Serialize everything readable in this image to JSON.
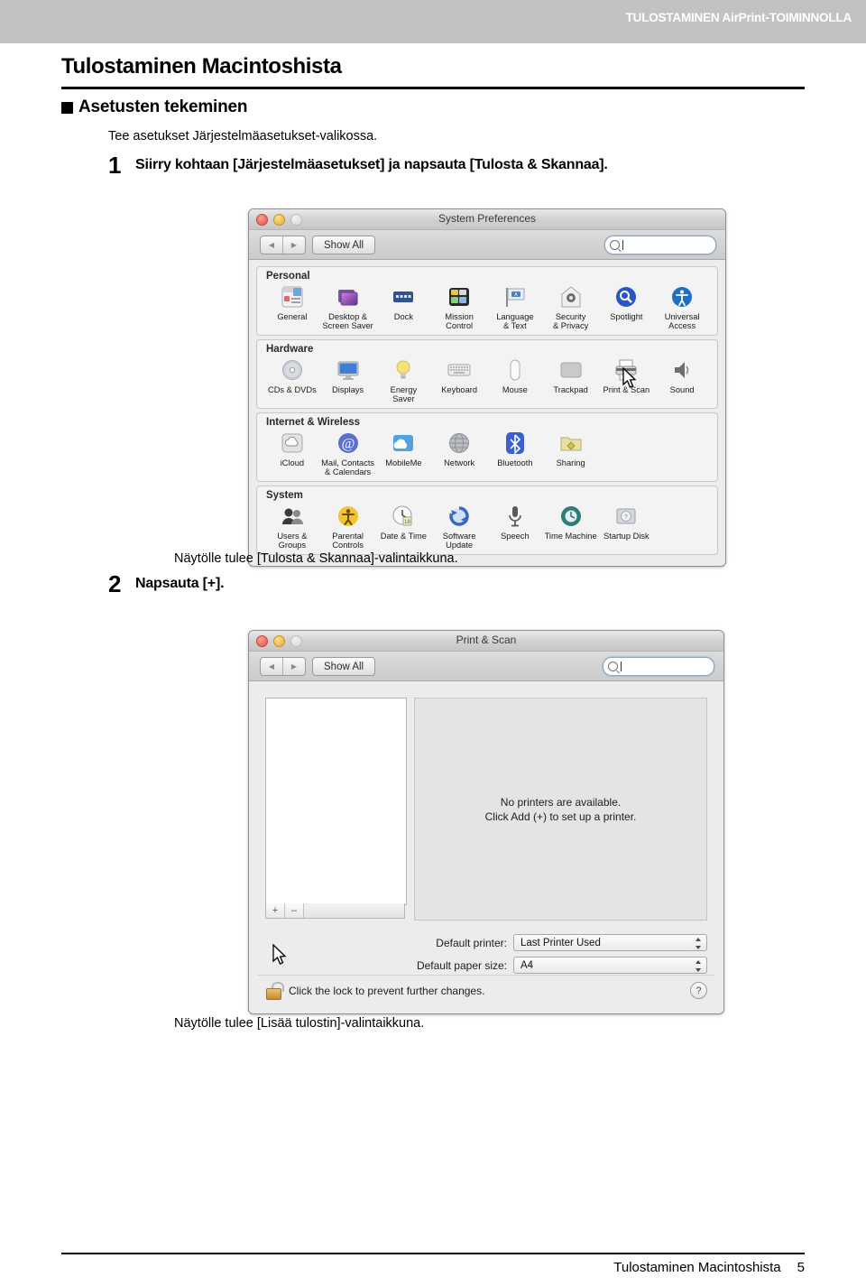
{
  "header": {
    "running_head": "TULOSTAMINEN AirPrint-TOIMINNOLLA",
    "band_color": "#c2c2c2"
  },
  "page": {
    "chapter_title": "Tulostaminen Macintoshista",
    "section_title": "Asetusten tekeminen",
    "intro": "Tee asetukset Järjestelmäasetukset-valikossa.",
    "footer_title": "Tulostaminen Macintoshista",
    "footer_page": "5"
  },
  "steps": [
    {
      "number": "1",
      "text": "Siirry kohtaan [Järjestelmäasetukset] ja napsauta [Tulosta & Skannaa].",
      "caption_after": "Näytölle tulee [Tulosta & Skannaa]-valintaikkuna."
    },
    {
      "number": "2",
      "text": "Napsauta [+].",
      "caption_after": "Näytölle tulee [Lisää tulostin]-valintaikkuna."
    }
  ],
  "system_preferences": {
    "window_title": "System Preferences",
    "toolbar": {
      "back_label": "◀",
      "forward_label": "▶",
      "show_all_label": "Show All",
      "search_placeholder": "",
      "search_value": ""
    },
    "groups": [
      {
        "title": "Personal",
        "items": [
          {
            "label": "General",
            "icon": "general-icon"
          },
          {
            "label": "Desktop &\nScreen Saver",
            "icon": "desktop-screensaver-icon"
          },
          {
            "label": "Dock",
            "icon": "dock-icon"
          },
          {
            "label": "Mission\nControl",
            "icon": "mission-control-icon"
          },
          {
            "label": "Language\n& Text",
            "icon": "language-text-icon"
          },
          {
            "label": "Security\n& Privacy",
            "icon": "security-privacy-icon"
          },
          {
            "label": "Spotlight",
            "icon": "spotlight-icon"
          },
          {
            "label": "Universal\nAccess",
            "icon": "universal-access-icon"
          }
        ]
      },
      {
        "title": "Hardware",
        "items": [
          {
            "label": "CDs & DVDs",
            "icon": "cds-dvds-icon"
          },
          {
            "label": "Displays",
            "icon": "displays-icon"
          },
          {
            "label": "Energy\nSaver",
            "icon": "energy-saver-icon"
          },
          {
            "label": "Keyboard",
            "icon": "keyboard-icon"
          },
          {
            "label": "Mouse",
            "icon": "mouse-icon"
          },
          {
            "label": "Trackpad",
            "icon": "trackpad-icon"
          },
          {
            "label": "Print & Scan",
            "icon": "print-scan-icon"
          },
          {
            "label": "Sound",
            "icon": "sound-icon"
          }
        ]
      },
      {
        "title": "Internet & Wireless",
        "items": [
          {
            "label": "iCloud",
            "icon": "icloud-icon"
          },
          {
            "label": "Mail, Contacts\n& Calendars",
            "icon": "mail-contacts-calendars-icon"
          },
          {
            "label": "MobileMe",
            "icon": "mobileme-icon"
          },
          {
            "label": "Network",
            "icon": "network-icon"
          },
          {
            "label": "Bluetooth",
            "icon": "bluetooth-icon"
          },
          {
            "label": "Sharing",
            "icon": "sharing-icon"
          }
        ]
      },
      {
        "title": "System",
        "items": [
          {
            "label": "Users &\nGroups",
            "icon": "users-groups-icon"
          },
          {
            "label": "Parental\nControls",
            "icon": "parental-controls-icon"
          },
          {
            "label": "Date & Time",
            "icon": "date-time-icon"
          },
          {
            "label": "Software\nUpdate",
            "icon": "software-update-icon"
          },
          {
            "label": "Speech",
            "icon": "speech-icon"
          },
          {
            "label": "Time Machine",
            "icon": "time-machine-icon"
          },
          {
            "label": "Startup Disk",
            "icon": "startup-disk-icon"
          }
        ]
      }
    ]
  },
  "print_scan": {
    "window_title": "Print & Scan",
    "toolbar": {
      "back_label": "◀",
      "forward_label": "▶",
      "show_all_label": "Show All",
      "search_value": ""
    },
    "empty_message_line1": "No printers are available.",
    "empty_message_line2": "Click Add (+) to set up a printer.",
    "add_button_label": "+",
    "remove_button_label": "–",
    "default_printer_label": "Default printer:",
    "default_printer_value": "Last Printer Used",
    "default_paper_size_label": "Default paper size:",
    "default_paper_size_value": "A4",
    "lock_message": "Click the lock to prevent further changes.",
    "help_label": "?"
  }
}
